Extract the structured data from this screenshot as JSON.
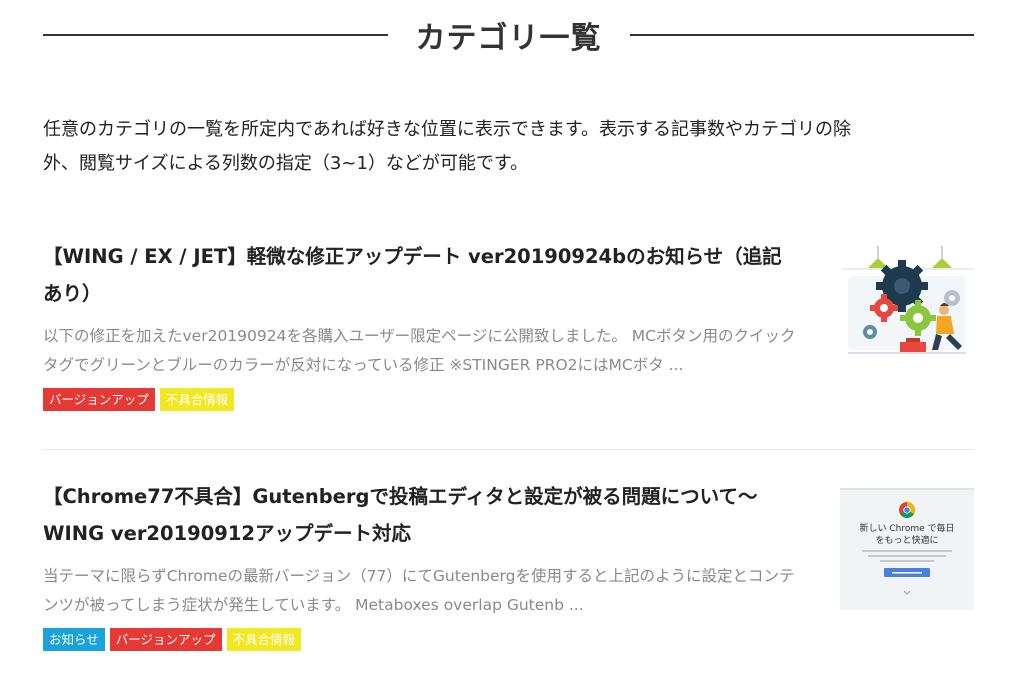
{
  "section": {
    "title": "カテゴリ一覧"
  },
  "intro": {
    "line1": "任意のカテゴリの一覧を所定内であれば好きな位置に表示できます。表示する記事数やカテゴリの除",
    "line2": "外、閲覧サイズによる列数の指定（3~1）などが可能です。"
  },
  "posts": [
    {
      "title_line1": "【WING / EX / JET】軽微な修正アップデート ver20190924bのお知らせ（追記",
      "title_line2": "あり）",
      "excerpt_line1": "以下の修正を加えたver20190924を各購入ユーザー限定ページに公開致しました。 MCボタン用のクイック",
      "excerpt_line2": "タグでグリーンとブルーのカラーが反対になっている修正 ※STINGER PRO2にはMCボタ ...",
      "tags": [
        {
          "label": "バージョンアップ",
          "color": "#e53935"
        },
        {
          "label": "不具合情報",
          "color": "#f2e822"
        }
      ]
    },
    {
      "title_line1": "【Chrome77不具合】Gutenbergで投稿エディタと設定が被る問題について〜",
      "title_line2": "WING ver20190912アップデート対応",
      "excerpt_line1": "当テーマに限らずChromeの最新バージョン（77）にてGutenbergを使用すると上記のように設定とコンテ",
      "excerpt_line2": "ンツが被ってしまう症状が発生しています。 Metaboxes overlap Gutenb ...",
      "tags": [
        {
          "label": "お知らせ",
          "color": "#1aa3d9"
        },
        {
          "label": "バージョンアップ",
          "color": "#e53935"
        },
        {
          "label": "不具合情報",
          "color": "#f2e822"
        }
      ],
      "thumb": {
        "headline_line1": "新しい Chrome で毎日",
        "headline_line2": "をもっと快適に"
      }
    }
  ]
}
